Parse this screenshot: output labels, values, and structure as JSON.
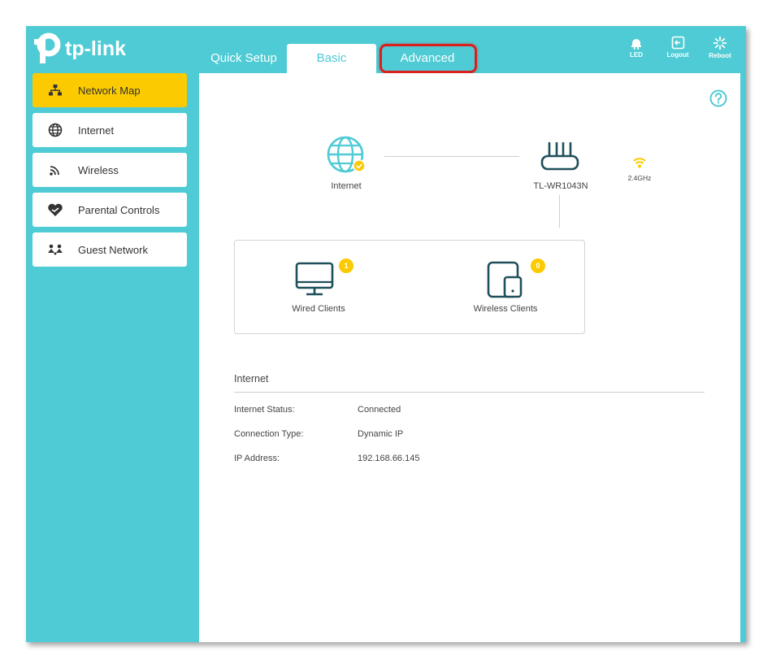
{
  "brand": {
    "name": "tp-link"
  },
  "tabs": [
    {
      "label": "Quick Setup"
    },
    {
      "label": "Basic"
    },
    {
      "label": "Advanced"
    }
  ],
  "top_actions": [
    {
      "label": "LED",
      "icon": "led-icon"
    },
    {
      "label": "Logout",
      "icon": "logout-icon"
    },
    {
      "label": "Reboot",
      "icon": "reboot-icon"
    }
  ],
  "sidebar": {
    "items": [
      {
        "label": "Network Map",
        "icon": "network-map-icon",
        "active": true
      },
      {
        "label": "Internet",
        "icon": "globe-icon"
      },
      {
        "label": "Wireless",
        "icon": "wireless-icon"
      },
      {
        "label": "Parental Controls",
        "icon": "parental-controls-icon"
      },
      {
        "label": "Guest Network",
        "icon": "guest-network-icon"
      }
    ]
  },
  "network_map": {
    "internet_label": "Internet",
    "router_label": "TL-WR1043N",
    "band_label": "2.4GHz",
    "wired_clients": {
      "label": "Wired Clients",
      "count": "1"
    },
    "wireless_clients": {
      "label": "Wireless Clients",
      "count": "0"
    }
  },
  "internet_info": {
    "title": "Internet",
    "rows": [
      {
        "label": "Internet Status:",
        "value": "Connected"
      },
      {
        "label": "Connection Type:",
        "value": "Dynamic IP"
      },
      {
        "label": "IP Address:",
        "value": "192.168.66.145"
      }
    ]
  },
  "colors": {
    "teal": "#4ecbd4",
    "accent_yellow": "#fcca00",
    "highlight_red": "#d9201e",
    "icon_dark": "#1f4f5a"
  }
}
